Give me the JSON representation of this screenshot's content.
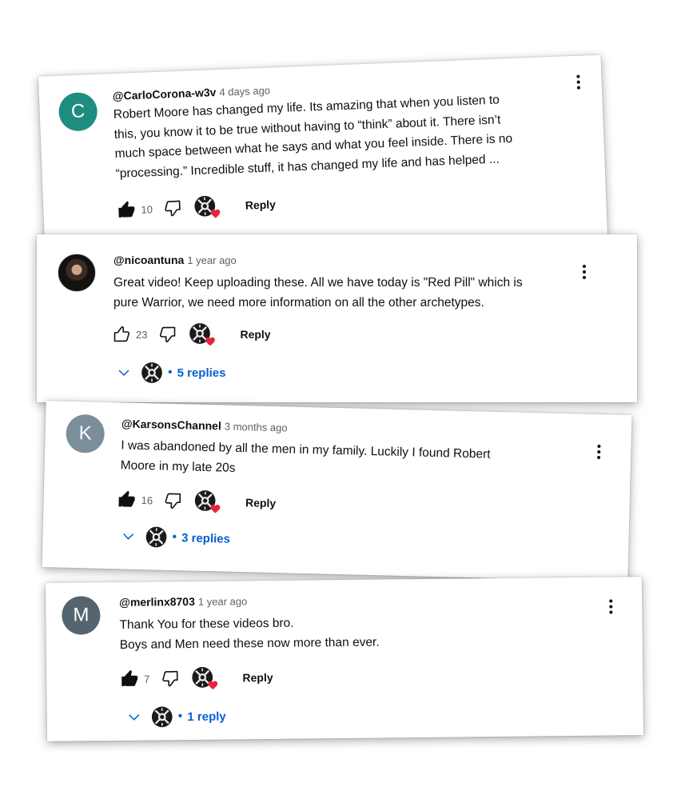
{
  "colors": {
    "link_blue": "#065fd4",
    "avatar_c": "#1e8c7e",
    "avatar_k": "#7b8f9a",
    "avatar_m": "#546571",
    "heart": "#e8243b"
  },
  "comments": [
    {
      "avatar_letter": "C",
      "handle": "@CarloCorona-w3v",
      "time": "4 days ago",
      "lines": [
        "Robert Moore has changed my life. Its amazing that when you listen to",
        "this, you know it to be true without having to “think” about it. There isn’t",
        "much space between what he says and what you feel inside. There is no",
        "“processing.” Incredible stuff, it has changed my life and has helped ..."
      ],
      "likes": "10",
      "liked": true,
      "reply_label": "Reply"
    },
    {
      "avatar_letter": "",
      "handle": "@nicoantuna",
      "time": "1 year ago",
      "lines": [
        "Great video! Keep uploading these. All we have today is \"Red Pill\" which is",
        "pure Warrior, we need more information on all the other archetypes."
      ],
      "likes": "23",
      "liked": false,
      "reply_label": "Reply",
      "replies_label": "5 replies"
    },
    {
      "avatar_letter": "K",
      "handle": "@KarsonsChannel",
      "time": "3 months ago",
      "lines": [
        "I was abandoned by all the men in my family. Luckily I found Robert",
        "Moore in my late 20s"
      ],
      "likes": "16",
      "liked": true,
      "reply_label": "Reply",
      "replies_label": "3 replies"
    },
    {
      "avatar_letter": "M",
      "handle": "@merlinx8703",
      "time": "1 year ago",
      "lines": [
        "Thank You for these videos bro.",
        "Boys and Men need these now more than ever."
      ],
      "likes": "7",
      "liked": true,
      "reply_label": "Reply",
      "replies_label": "1 reply"
    }
  ]
}
